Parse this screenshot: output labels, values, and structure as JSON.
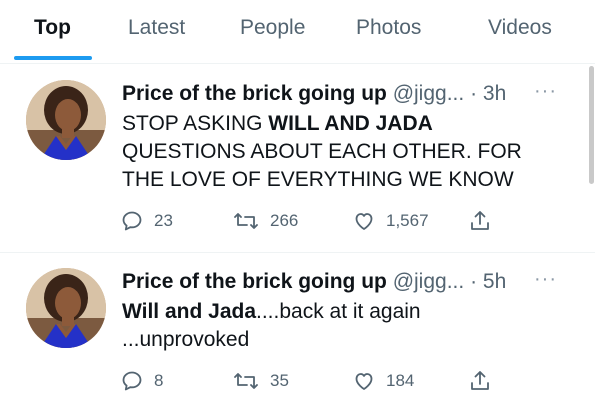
{
  "tabs": [
    {
      "label": "Top",
      "active": true
    },
    {
      "label": "Latest",
      "active": false
    },
    {
      "label": "People",
      "active": false
    },
    {
      "label": "Photos",
      "active": false
    },
    {
      "label": "Videos",
      "active": false
    }
  ],
  "tweets": [
    {
      "name": "Price of the brick going up",
      "handle": "@jigg...",
      "time": "· 3h",
      "text_bold": "WILL AND JADA",
      "text_pre": "STOP ASKING ",
      "text_post": " QUESTIONS ABOUT EACH OTHER. FOR THE LOVE OF EVERYTHING WE KNOW",
      "replies": "23",
      "retweets": "266",
      "likes": "1,567"
    },
    {
      "name": "Price of the brick going up",
      "handle": "@jigg...",
      "time": "· 5h",
      "text_bold": "Will and Jada",
      "text_pre": "",
      "text_post": "....back at it again ...unprovoked",
      "replies": "8",
      "retweets": "35",
      "likes": "184"
    }
  ],
  "more_label": "···",
  "colors": {
    "accent": "#1d9bf0",
    "muted": "#536471",
    "text": "#0f1419"
  },
  "icons": [
    "reply-icon",
    "retweet-icon",
    "like-icon",
    "share-icon",
    "more-icon"
  ]
}
